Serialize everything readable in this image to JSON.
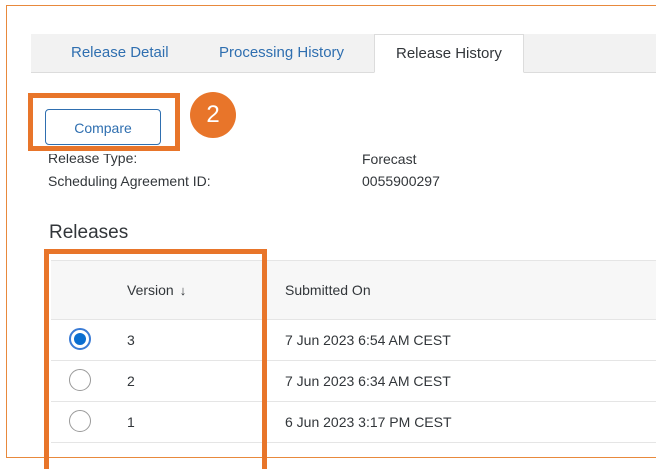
{
  "tabs": [
    {
      "label": "Release Detail",
      "active": false
    },
    {
      "label": "Processing History",
      "active": false
    },
    {
      "label": "Release History",
      "active": true
    }
  ],
  "toolbar": {
    "compare_label": "Compare"
  },
  "annotation": {
    "step_number": "2",
    "color": "#e8752a"
  },
  "info": {
    "release_type_label": "Release Type:",
    "release_type_value": "Forecast",
    "agreement_label": "Scheduling Agreement ID:",
    "agreement_value": "0055900297"
  },
  "releases": {
    "title": "Releases",
    "columns": {
      "version": "Version",
      "submitted_on": "Submitted On"
    },
    "sort_icon": "↓",
    "rows": [
      {
        "selected": true,
        "version": "3",
        "submitted_on": "7 Jun 2023 6:54 AM CEST"
      },
      {
        "selected": false,
        "version": "2",
        "submitted_on": "7 Jun 2023 6:34 AM CEST"
      },
      {
        "selected": false,
        "version": "1",
        "submitted_on": "6 Jun 2023 3:17 PM CEST"
      }
    ]
  },
  "colors": {
    "accent": "#2f6fb0",
    "highlight": "#e8752a",
    "radio_selected": "#0a6ed1"
  }
}
